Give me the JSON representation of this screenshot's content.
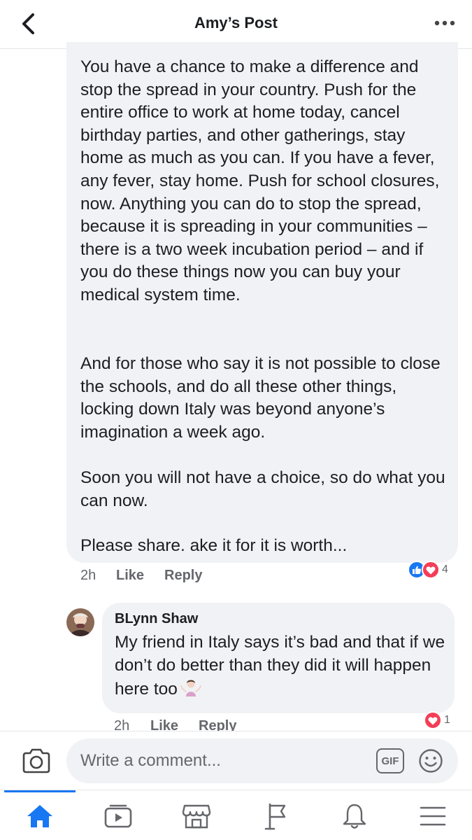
{
  "header": {
    "title": "Amy’s Post",
    "back_icon": "chevron-left-icon",
    "more_icon": "more-horizontal-icon"
  },
  "comment": {
    "paragraphs": [
      "You have a chance to make a difference and stop the spread in your country. Push for the entire office to work at home today, cancel birthday parties, and other gatherings, stay home as much as you can. If you have a fever, any fever, stay home. Push for school closures, now. Anything you can do to stop the spread, because it is spreading in your communities – there is a two week incubation period – and if you do these things now you can buy your medical system time.",
      "And for those who say it is not possible to close the schools, and do all these other things, locking down Italy was beyond anyone’s imagination a week ago.",
      "Soon you will not have a choice, so do what you can now.",
      "Please share. ake it for it is worth..."
    ],
    "time": "2h",
    "like_label": "Like",
    "reply_label": "Reply",
    "reaction_count": "4",
    "reactions": [
      "like",
      "love"
    ]
  },
  "reply": {
    "author": "BLynn Shaw",
    "text": "My friend in Italy says it’s bad and that if we don’t do better than they did it will happen here too",
    "emoji": "person-shrugging-emoji",
    "time": "2h",
    "like_label": "Like",
    "reply_label": "Reply",
    "reaction_count": "1",
    "reactions": [
      "love"
    ]
  },
  "composer": {
    "placeholder": "Write a comment...",
    "gif_label": "GIF",
    "camera_icon": "camera-icon",
    "emoji_icon": "smiley-icon"
  },
  "nav": {
    "items": [
      "home-icon",
      "watch-icon",
      "marketplace-icon",
      "pages-flag-icon",
      "notifications-bell-icon",
      "menu-icon"
    ],
    "active": "home-icon"
  },
  "colors": {
    "accent": "#1877f2",
    "bubble": "#f0f2f5",
    "secondary_text": "#65676b",
    "love": "#f33e58"
  }
}
